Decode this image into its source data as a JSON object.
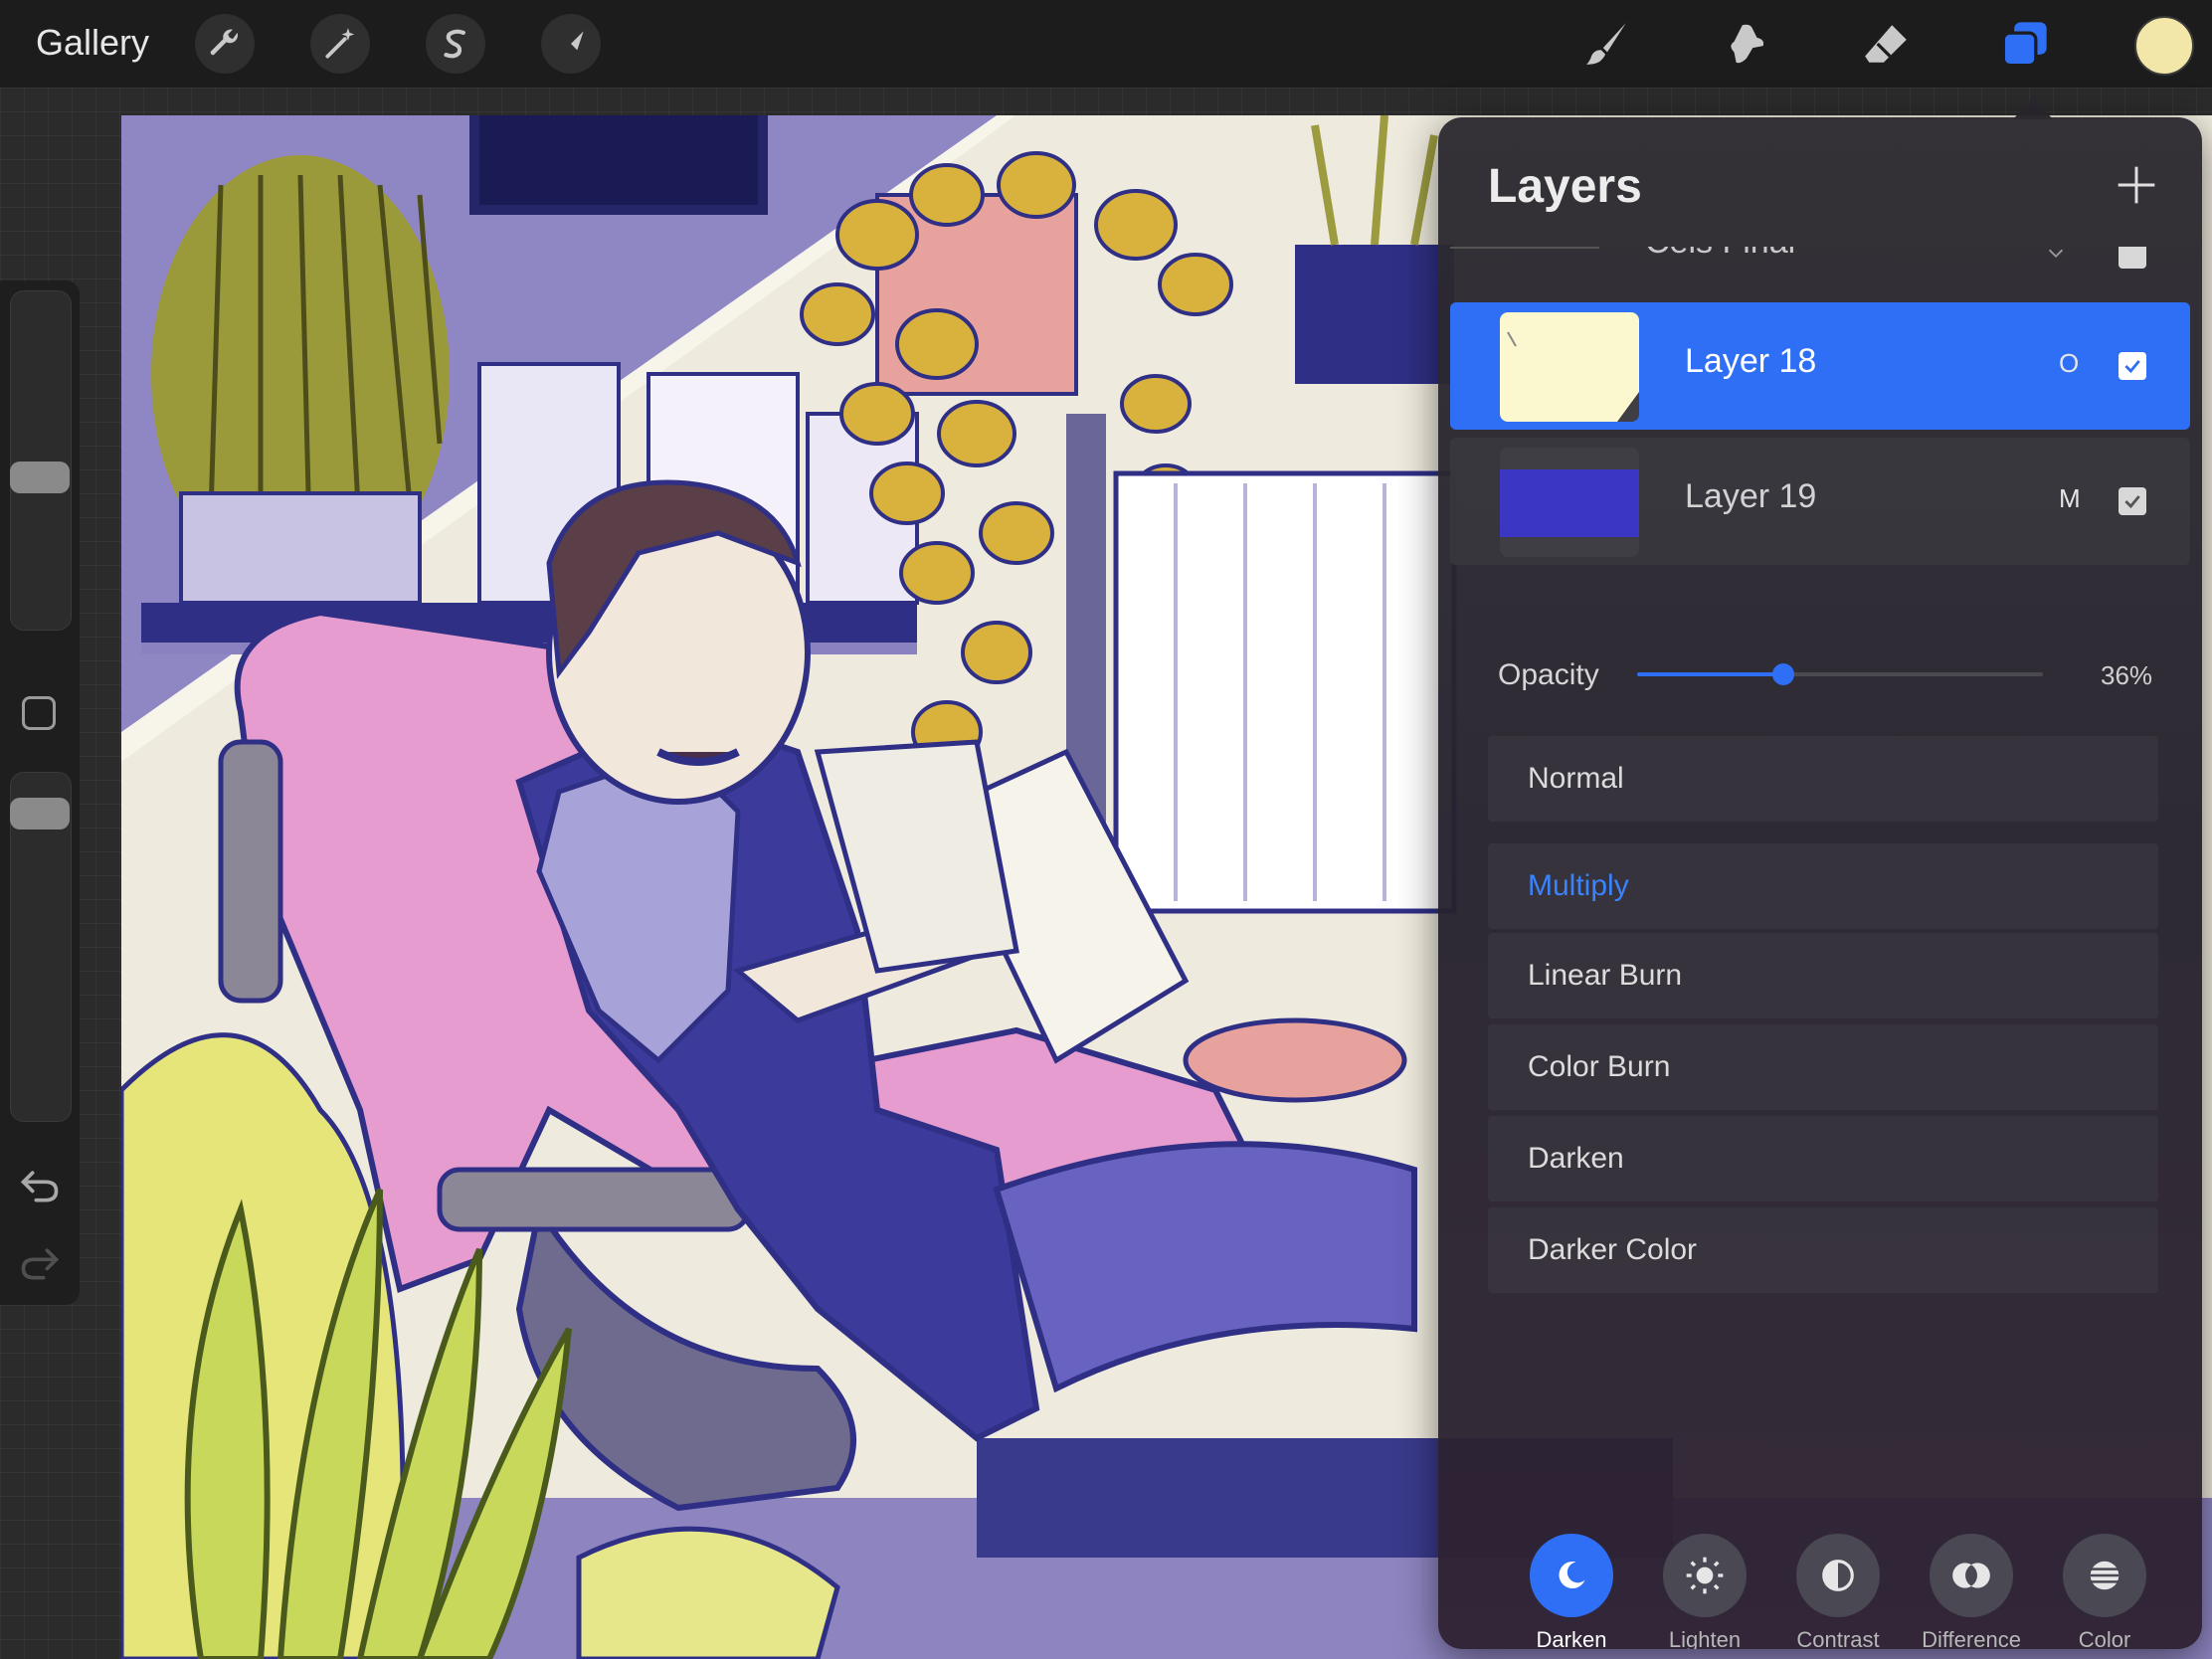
{
  "topbar": {
    "gallery_label": "Gallery",
    "left_tools": [
      "wrench-icon",
      "magic-wand-icon",
      "selection-s-icon",
      "transform-arrow-icon"
    ],
    "right_tools": [
      "brush-icon",
      "smudge-icon",
      "eraser-icon",
      "layers-icon"
    ],
    "current_color": "#f2e7a8"
  },
  "panel": {
    "title": "Layers",
    "group_name": "Cels Final",
    "layers": [
      {
        "name": "Layer 18",
        "blend": "O",
        "visible": true,
        "selected": true
      },
      {
        "name": "Layer 19",
        "blend": "M",
        "visible": true,
        "selected": false
      }
    ],
    "opacity_label": "Opacity",
    "opacity_value": "36%",
    "opacity_fraction": 0.36,
    "blend_modes": [
      "Normal",
      "Multiply",
      "Linear Burn",
      "Color Burn",
      "Darken",
      "Darker Color"
    ],
    "active_blend": "Multiply",
    "categories": [
      "Darken",
      "Lighten",
      "Contrast",
      "Difference",
      "Color"
    ],
    "active_category": "Darken"
  },
  "colors": {
    "accent": "#2f6ff5",
    "panel_bg": "#2c2a30"
  }
}
